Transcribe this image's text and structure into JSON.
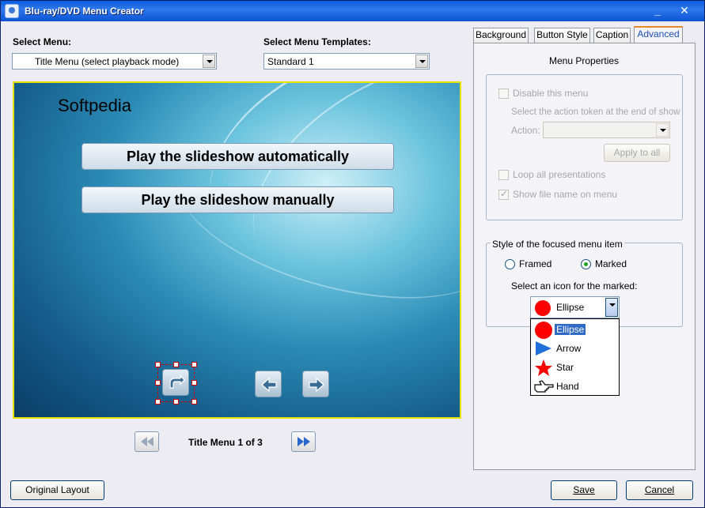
{
  "window": {
    "title": "Blu-ray/DVD Menu Creator",
    "minimize": "_",
    "close": "✕"
  },
  "select_menu": {
    "label": "Select Menu:",
    "value": "Title Menu (select playback mode)"
  },
  "select_template": {
    "label": "Select Menu Templates:",
    "value": "Standard 1"
  },
  "preview": {
    "site_text": "Softpedia",
    "buttons": [
      "Play the slideshow automatically",
      "Play the slideshow manually"
    ],
    "icons": [
      "return-icon",
      "arrow-left-icon",
      "arrow-right-icon"
    ]
  },
  "pager": {
    "label": "Title Menu 1 of 3",
    "prev_icon": "rewind-icon",
    "next_icon": "fast-forward-icon"
  },
  "footer": {
    "original_layout": "Original Layout",
    "save": "Save",
    "cancel": "Cancel"
  },
  "tabs": [
    "Background",
    "Button Style",
    "Caption",
    "Advanced"
  ],
  "advanced": {
    "menu_properties_title": "Menu Properties",
    "disable_menu": "Disable this menu",
    "action_token_text": "Select the action token at the end of show",
    "action_label": "Action:",
    "action_value": "",
    "apply_to_all": "Apply to all",
    "loop_all": "Loop all presentations",
    "loop_checked": false,
    "show_file_name": "Show file name on menu",
    "show_file_name_checked": true,
    "focused_style_title": "Style of the focused menu item",
    "framed": "Framed",
    "marked": "Marked",
    "selected_style": "Marked",
    "icon_prompt": "Select an icon for the marked:",
    "icon_value": "Ellipse",
    "icon_options": [
      "Ellipse",
      "Arrow",
      "Star",
      "Hand"
    ],
    "icon_selected_index": 0
  },
  "colors": {
    "accent": "#316ac5",
    "marker_red": "#ff0000",
    "arrow_blue": "#1e6fd9",
    "preview_border": "#e8e200"
  }
}
